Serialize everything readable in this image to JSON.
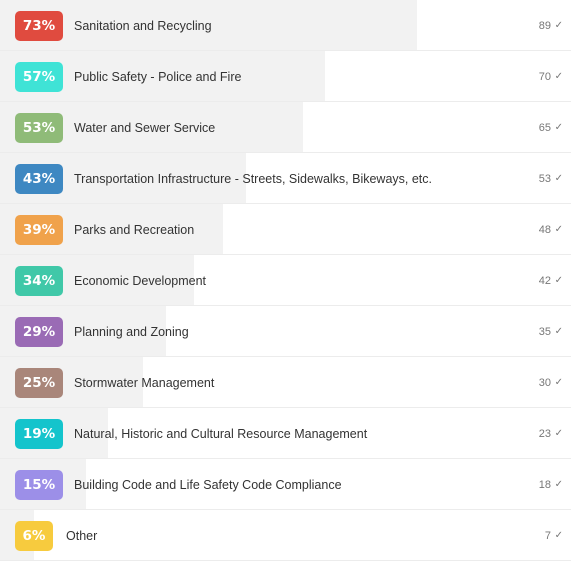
{
  "results": [
    {
      "percent_label": "73%",
      "percent": 73,
      "label": "Sanitation and Recycling",
      "count": "89",
      "check_icon": "checkmark-icon",
      "color": "#E04B3F"
    },
    {
      "percent_label": "57%",
      "percent": 57,
      "label": "Public Safety - Police and Fire",
      "count": "70",
      "check_icon": "checkmark-icon",
      "color": "#3FE3D6"
    },
    {
      "percent_label": "53%",
      "percent": 53,
      "label": "Water and Sewer Service",
      "count": "65",
      "check_icon": "checkmark-icon",
      "color": "#8FBB78"
    },
    {
      "percent_label": "43%",
      "percent": 43,
      "label": "Transportation Infrastructure - Streets, Sidewalks, Bikeways, etc.",
      "count": "53",
      "check_icon": "checkmark-icon",
      "color": "#3E88C2"
    },
    {
      "percent_label": "39%",
      "percent": 39,
      "label": "Parks and Recreation",
      "count": "48",
      "check_icon": "checkmark-icon",
      "color": "#F0A24B"
    },
    {
      "percent_label": "34%",
      "percent": 34,
      "label": "Economic Development",
      "count": "42",
      "check_icon": "checkmark-icon",
      "color": "#40C8A8"
    },
    {
      "percent_label": "29%",
      "percent": 29,
      "label": "Planning and Zoning",
      "count": "35",
      "check_icon": "checkmark-icon",
      "color": "#9A6BB5"
    },
    {
      "percent_label": "25%",
      "percent": 25,
      "label": "Stormwater Management",
      "count": "30",
      "check_icon": "checkmark-icon",
      "color": "#A9867A"
    },
    {
      "percent_label": "19%",
      "percent": 19,
      "label": "Natural, Historic and Cultural Resource Management",
      "count": "23",
      "check_icon": "checkmark-icon",
      "color": "#14C4CC"
    },
    {
      "percent_label": "15%",
      "percent": 15,
      "label": "Building Code and Life Safety Code Compliance",
      "count": "18",
      "check_icon": "checkmark-icon",
      "color": "#9C8FE8"
    },
    {
      "percent_label": "6%",
      "percent": 6,
      "label": "Other",
      "count": "7",
      "check_icon": "checkmark-icon",
      "color": "#F7CB3E"
    }
  ]
}
